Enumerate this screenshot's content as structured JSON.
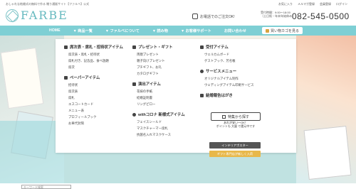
{
  "topbar": {
    "tagline": "おしゃれな結婚式の無料で作る 贈り通販サイト【ファルベ】公式",
    "links": [
      "お気に入り",
      "メルマガ登録",
      "会員登録",
      "ログイン"
    ]
  },
  "header": {
    "logo_text": "FARBE",
    "phone_label": "お電話でのご注文OK!",
    "hours_line1": "受付時間：9:00～18:00",
    "hours_line2": "（土日祝・年末年始休み）",
    "phone_number": "082-545-0500"
  },
  "nav": {
    "items": [
      "HOME",
      "▼ 商品一覧",
      "▼ ファルベについて",
      "▼ 読み物",
      "▼ お客様サポート",
      "お問い合わせ"
    ],
    "cart_label": "買い物カゴを見る"
  },
  "menu": {
    "col1": [
      {
        "title": "席次表・席札・招待状アイテム",
        "items": [
          "席次表・席札・招待状",
          "席札付き、記念品、食べ放題",
          "席次"
        ]
      },
      {
        "title": "ペーパーアイテム",
        "items": [
          "招待状",
          "席次表",
          "席札",
          "エスコートカード",
          "メニュー表",
          "プロフィールブック",
          "お車代封筒"
        ]
      }
    ],
    "col2": [
      {
        "title": "プレゼント・ギフト",
        "items": [
          "両親プレゼント",
          "親子向けプレゼント",
          "プチギフト、お礼",
          "カタログギフト"
        ]
      },
      {
        "title": "演出アイテム",
        "items": [
          "花嫁の手紙",
          "結婚証明書",
          "リングピロー"
        ]
      },
      {
        "title": "withコロナ 新様式アイテム",
        "items": [
          "フェイスシールド",
          "マスクチャーマー席札",
          "抗菌名入れマスクケース"
        ]
      }
    ],
    "col3": [
      {
        "title": "受付アイテム",
        "items": [
          "ウェルカムボード",
          "ゲストブック、芳名帳"
        ]
      },
      {
        "title": "サービスメニュー",
        "items": [
          "オリジナルアイテム制作",
          "ウェディングアイテム印刷サービス"
        ]
      },
      {
        "title": "結婚報告はがき",
        "items": []
      }
    ],
    "search_button": "特集から探す",
    "note_line1": "あれが安い〜OK！",
    "note_line2": "ポイントも 大量 で還元中です",
    "interior_button": "インテリアポスター",
    "gift_button": "ギフト専門店が新しく入荷"
  },
  "bottom": {
    "search_placeholder": "キーワード検索"
  }
}
